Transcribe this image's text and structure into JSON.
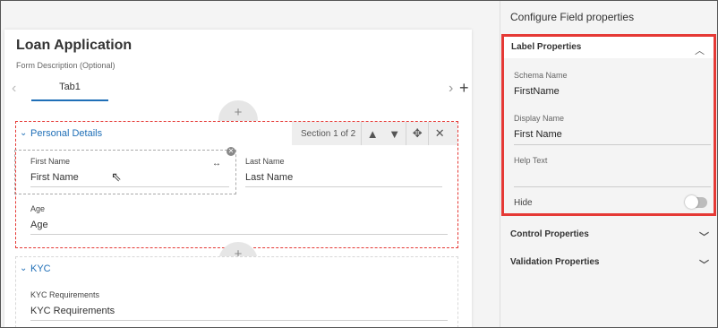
{
  "form": {
    "title": "Loan Application",
    "description": "Form Description (Optional)",
    "tabs": [
      {
        "label": "Tab1"
      }
    ],
    "tab_prev": "‹",
    "tab_next": "›",
    "tab_add": "+",
    "add_section": "+"
  },
  "sections": [
    {
      "title": "Personal Details",
      "count": "Section 1 of 2",
      "fields": [
        {
          "label": "First Name",
          "value": "First Name"
        },
        {
          "label": "Last Name",
          "value": "Last Name"
        },
        {
          "label": "Age",
          "value": "Age"
        }
      ]
    },
    {
      "title": "KYC",
      "fields": [
        {
          "label": "KYC Requirements",
          "value": "KYC Requirements"
        }
      ]
    }
  ],
  "panel": {
    "title": "Configure Field properties",
    "label_properties": {
      "title": "Label Properties",
      "schema_name_label": "Schema Name",
      "schema_name_value": "FirstName",
      "display_name_label": "Display Name",
      "display_name_value": "First Name",
      "help_text_label": "Help Text",
      "help_text_value": "",
      "hide_label": "Hide",
      "hide_on": false
    },
    "control_properties": "Control Properties",
    "validation_properties": "Validation Properties"
  },
  "icons": {
    "chevron_up": "⌃",
    "chevron_down": "⌄",
    "section_chevron": "⌄",
    "move": "✥",
    "close": "✕",
    "resize": "↔",
    "cursor": "⇖"
  },
  "colors": {
    "accent": "#1f6fb7",
    "highlight": "#e53935"
  }
}
